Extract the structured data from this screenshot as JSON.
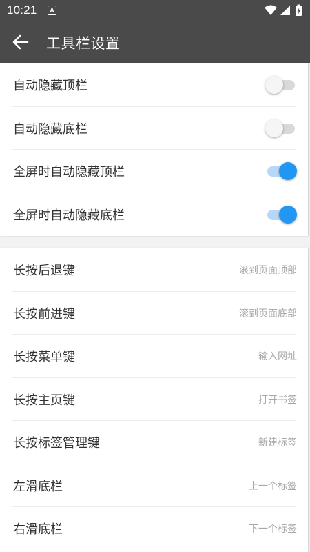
{
  "status_bar": {
    "time": "10:21",
    "notification_icon": "a-icon",
    "icons": [
      "wifi-icon",
      "signal-icon",
      "battery-charging-icon"
    ]
  },
  "app_bar": {
    "back_icon": "arrow-left-icon",
    "title": "工具栏设置"
  },
  "toggles": [
    {
      "label": "自动隐藏顶栏",
      "on": false
    },
    {
      "label": "自动隐藏底栏",
      "on": false
    },
    {
      "label": "全屏时自动隐藏顶栏",
      "on": true
    },
    {
      "label": "全屏时自动隐藏底栏",
      "on": true
    }
  ],
  "options": [
    {
      "label": "长按后退键",
      "value": "滚到页面顶部"
    },
    {
      "label": "长按前进键",
      "value": "滚到页面底部"
    },
    {
      "label": "长按菜单键",
      "value": "输入网址"
    },
    {
      "label": "长按主页键",
      "value": "打开书签"
    },
    {
      "label": "长按标签管理键",
      "value": "新建标签"
    },
    {
      "label": "左滑底栏",
      "value": "上一个标签"
    },
    {
      "label": "右滑底栏",
      "value": "下一个标签"
    }
  ],
  "colors": {
    "app_bar": "#4a4a4a",
    "accent": "#2196f3",
    "accent_track": "#b8d6f8",
    "background": "#f2f2f2"
  }
}
